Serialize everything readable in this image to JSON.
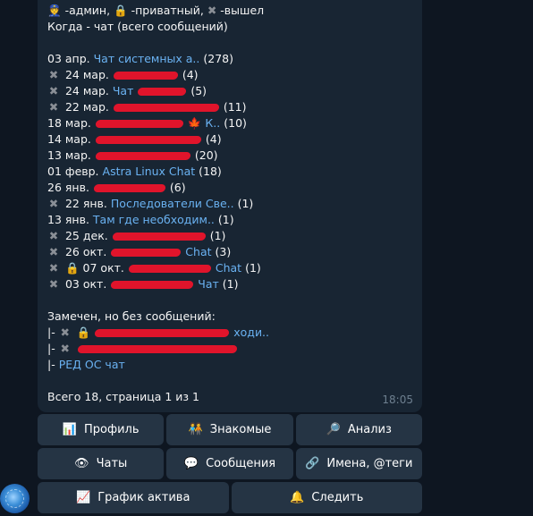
{
  "legend": {
    "admin_icon": "👮",
    "admin": "-админ,",
    "private_icon": "🔒",
    "private": "-приватный,",
    "left_icon": "✖",
    "left": "-вышел"
  },
  "subtitle": "Когда - чат (всего сообщений)",
  "chats": [
    {
      "date": "03 апр.",
      "name": "Чат системных а..",
      "count": "(278)"
    },
    {
      "date": "24 мар.",
      "name": "",
      "count": "(4)"
    },
    {
      "date": "24 мар.",
      "name": "Чат",
      "count": "(5)"
    },
    {
      "date": "22 мар.",
      "name": "",
      "count": "(11)"
    },
    {
      "date": "18 мар.",
      "name": "К..",
      "count": "(10)"
    },
    {
      "date": "14 мар.",
      "name": "",
      "count": "(4)"
    },
    {
      "date": "13 мар.",
      "name": "",
      "count": "(20)"
    },
    {
      "date": "01 февр.",
      "name": "Astra Linux Chat",
      "count": "(18)"
    },
    {
      "date": "26 янв.",
      "name": "",
      "count": "(6)"
    },
    {
      "date": "22 янв.",
      "name": "Последователи Све..",
      "count": "(1)"
    },
    {
      "date": "13 янв.",
      "name": "Там где необходим..",
      "count": "(1)"
    },
    {
      "date": "25 дек.",
      "name": "",
      "count": "(1)"
    },
    {
      "date": "26 окт.",
      "name": "Chat",
      "count": "(3)"
    },
    {
      "date": "07 окт.",
      "name": "Chat",
      "count": "(1)"
    },
    {
      "date": "03 окт.",
      "name": "Чат",
      "count": "(1)"
    }
  ],
  "seen_title": "Замечен, но без сообщений:",
  "seen_prefix": "|-",
  "seen": [
    {
      "name": "ходи.."
    },
    {
      "name": ""
    },
    {
      "name": "РЕД ОС чат"
    }
  ],
  "footer": {
    "prefix": "Всего ",
    "total": "18",
    "suffix": ", страница 1 из 1"
  },
  "time": "18:05",
  "buttons": {
    "profile": {
      "icon": "📊",
      "label": "Профиль"
    },
    "friends": {
      "icon": "🧑‍🤝‍🧑",
      "label": "Знакомые"
    },
    "analysis": {
      "icon": "🔎",
      "label": "Анализ"
    },
    "chats": {
      "icon": "👁",
      "label": "Чаты"
    },
    "messages": {
      "icon": "💬",
      "label": "Сообщения"
    },
    "names": {
      "icon": "🔗",
      "label": "Имена, @теги"
    },
    "activity": {
      "icon": "📈",
      "label": "График актива"
    },
    "follow": {
      "icon": "🔔",
      "label": "Следить"
    }
  },
  "colors": {
    "bubble": "#182533",
    "link": "#6ab2f2",
    "background": "#0e1621",
    "button": "#253444"
  }
}
